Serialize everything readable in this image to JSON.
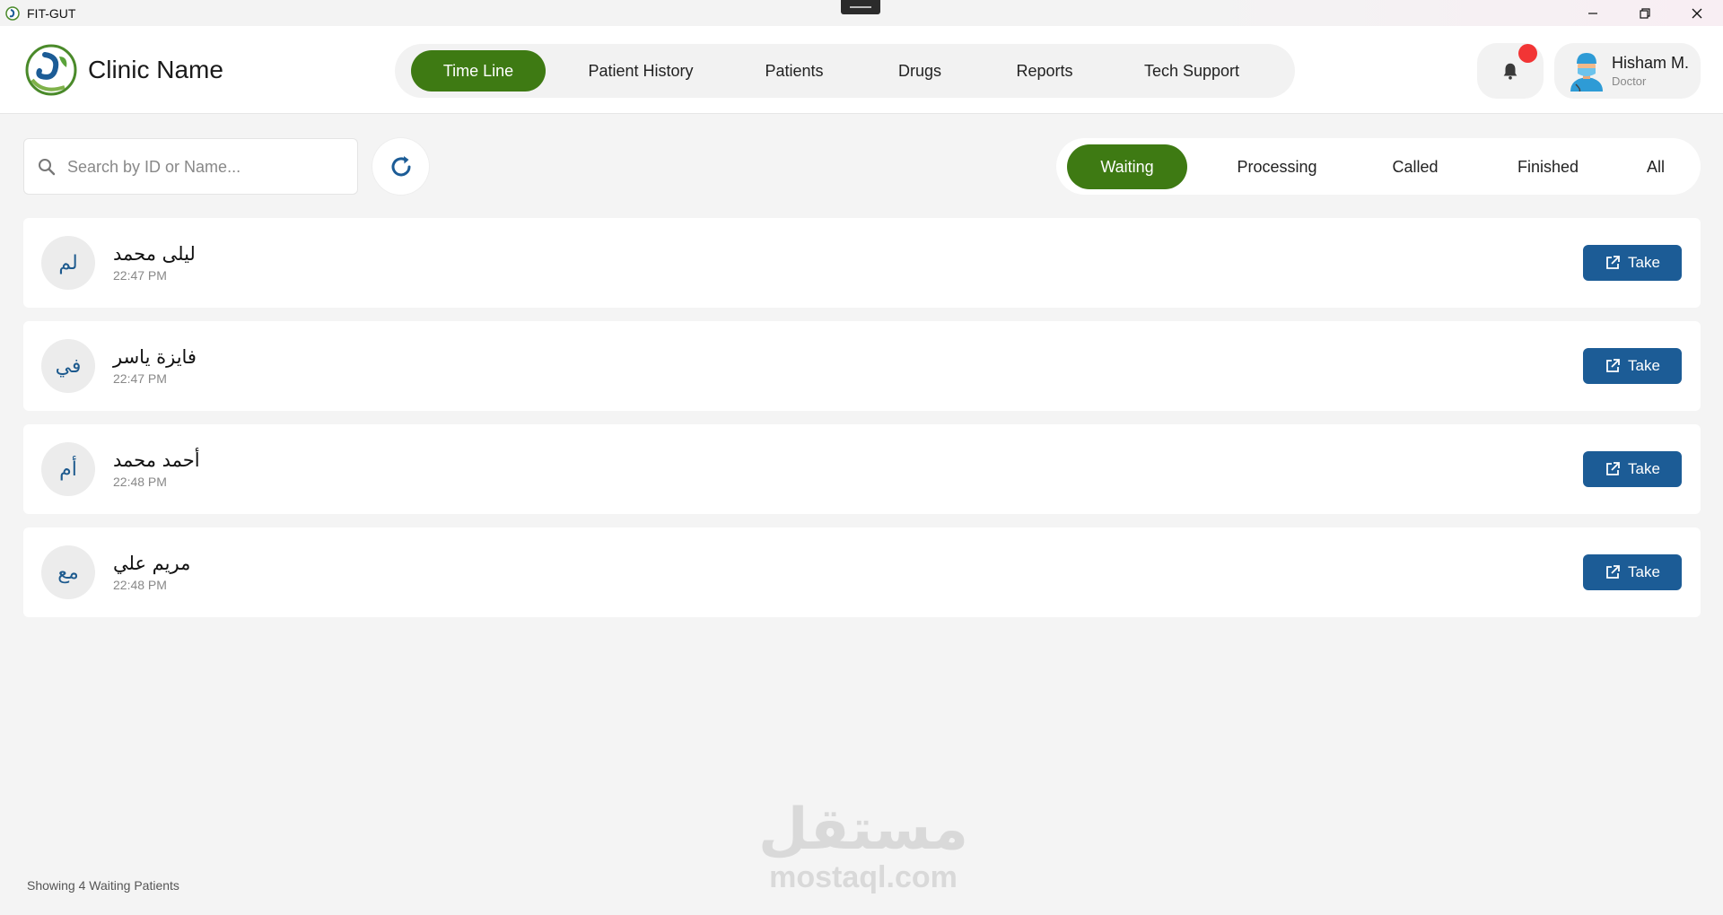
{
  "window": {
    "title": "FIT-GUT"
  },
  "header": {
    "clinic_name": "Clinic Name",
    "nav": [
      {
        "label": "Time Line",
        "active": true
      },
      {
        "label": "Patient History",
        "active": false
      },
      {
        "label": "Patients",
        "active": false
      },
      {
        "label": "Drugs",
        "active": false
      },
      {
        "label": "Reports",
        "active": false
      },
      {
        "label": "Tech Support",
        "active": false
      }
    ],
    "notification_icon": "bell-icon",
    "user": {
      "name": "Hisham M.",
      "role": "Doctor"
    }
  },
  "toolbar": {
    "search_placeholder": "Search by ID or Name...",
    "search_value": "",
    "refresh_icon": "refresh-icon",
    "status_tabs": [
      {
        "label": "Waiting",
        "active": true
      },
      {
        "label": "Processing",
        "active": false
      },
      {
        "label": "Called",
        "active": false
      },
      {
        "label": "Finished",
        "active": false
      },
      {
        "label": "All",
        "active": false
      }
    ]
  },
  "patients": [
    {
      "initials": "لم",
      "name": "ليلى محمد",
      "time": "22:47 PM",
      "action": "Take"
    },
    {
      "initials": "في",
      "name": "فايزة ياسر",
      "time": "22:47 PM",
      "action": "Take"
    },
    {
      "initials": "أم",
      "name": "أحمد محمد",
      "time": "22:48 PM",
      "action": "Take"
    },
    {
      "initials": "مع",
      "name": "مريم علي",
      "time": "22:48 PM",
      "action": "Take"
    }
  ],
  "footer": {
    "count_text": "Showing 4 Waiting Patients"
  },
  "watermark": {
    "arabic": "مستقل",
    "latin": "mostaql.com"
  },
  "colors": {
    "accent_green": "#3e7a13",
    "action_blue": "#1c5c96",
    "notification_red": "#f23535"
  }
}
